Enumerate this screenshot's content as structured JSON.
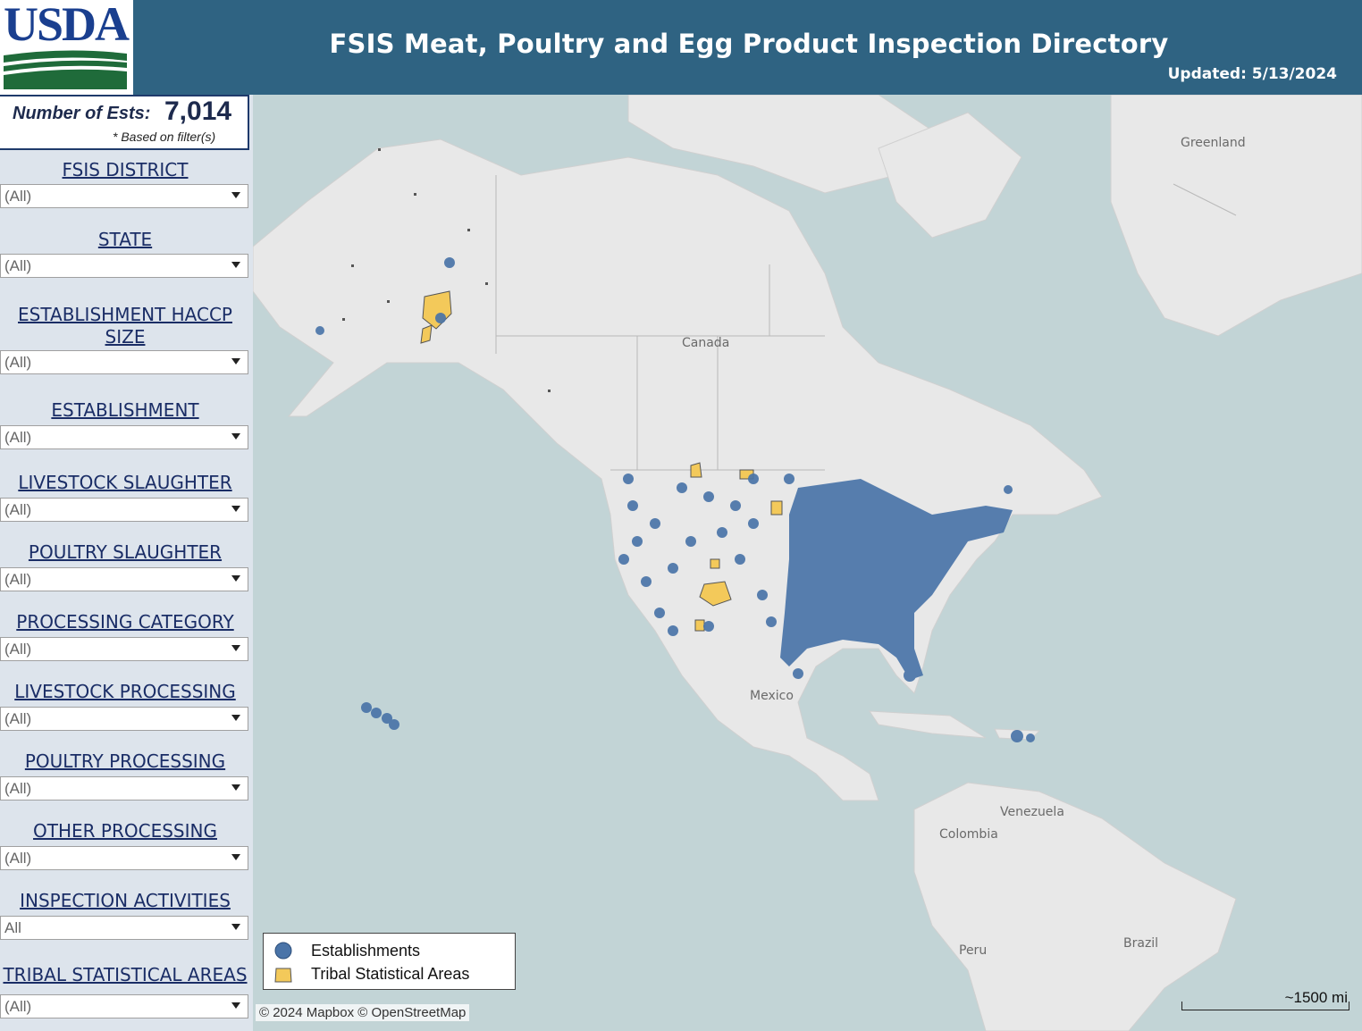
{
  "header": {
    "logo_text": "USDA",
    "title": "FSIS Meat, Poultry and Egg Product Inspection Directory",
    "updated": "Updated: 5/13/2024"
  },
  "summary": {
    "label": "Number of Ests:",
    "value": "7,014",
    "note": "* Based on filter(s)"
  },
  "filters": [
    {
      "label": "FSIS DISTRICT",
      "value": "(All)"
    },
    {
      "label": "STATE",
      "value": "(All)"
    },
    {
      "label": "ESTABLISHMENT HACCP SIZE",
      "value": "(All)"
    },
    {
      "label": "ESTABLISHMENT",
      "value": "(All)"
    },
    {
      "label": "LIVESTOCK SLAUGHTER",
      "value": "(All)"
    },
    {
      "label": "POULTRY SLAUGHTER",
      "value": "(All)"
    },
    {
      "label": "PROCESSING CATEGORY",
      "value": "(All)"
    },
    {
      "label": "LIVESTOCK PROCESSING",
      "value": "(All)"
    },
    {
      "label": "POULTRY PROCESSING",
      "value": "(All)"
    },
    {
      "label": "OTHER PROCESSING",
      "value": "(All)"
    },
    {
      "label": "INSPECTION ACTIVITIES",
      "value": "All"
    },
    {
      "label": "TRIBAL STATISTICAL AREAS",
      "value": "(All)"
    }
  ],
  "map": {
    "place_labels": {
      "greenland": "Greenland",
      "canada": "Canada",
      "mexico": "Mexico",
      "venezuela": "Venezuela",
      "colombia": "Colombia",
      "peru": "Peru",
      "brazil": "Brazil"
    },
    "legend": {
      "establishments": "Establishments",
      "tribal": "Tribal Statistical Areas"
    },
    "attribution": "© 2024 Mapbox  © OpenStreetMap",
    "scale": "~1500 mi",
    "colors": {
      "establishment": "#4a74a8",
      "tribal_fill": "#f3c95a",
      "water": "#c2d4d6",
      "land": "#e8e8e8"
    }
  }
}
